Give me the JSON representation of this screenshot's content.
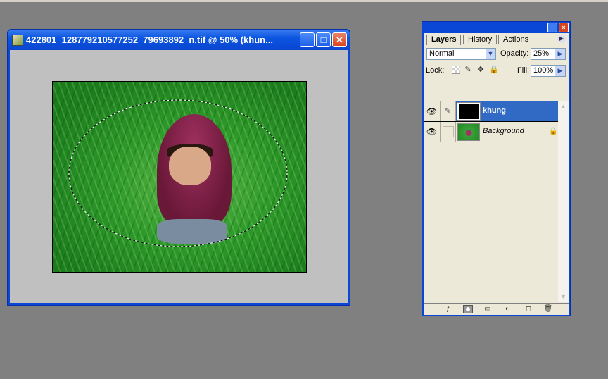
{
  "document": {
    "title": "422801_128779210577252_79693892_n.tif @ 50% (khun...",
    "icon": "photoshop-document-icon",
    "buttons": {
      "minimize": "_",
      "maximize": "□",
      "close": "✕"
    }
  },
  "layers_panel": {
    "tabs": [
      {
        "label": "Layers",
        "active": true
      },
      {
        "label": "History",
        "active": false
      },
      {
        "label": "Actions",
        "active": false
      }
    ],
    "blend_mode": "Normal",
    "opacity_label": "Opacity:",
    "opacity_value": "25%",
    "lock_label": "Lock:",
    "fill_label": "Fill:",
    "fill_value": "100%",
    "layers": [
      {
        "name": "khung",
        "visible": true,
        "selected": true,
        "thumbnail": "black"
      },
      {
        "name": "Background",
        "visible": true,
        "selected": false,
        "locked": true,
        "thumbnail": "photo"
      }
    ],
    "bottom_icons": [
      "layer-style-icon",
      "layer-mask-icon",
      "new-group-icon",
      "adjustment-layer-icon",
      "new-layer-icon",
      "trash-icon"
    ]
  },
  "colors": {
    "selection_highlight": "#316ac5",
    "titlebar": "#0a47d6",
    "workspace": "#808080"
  }
}
